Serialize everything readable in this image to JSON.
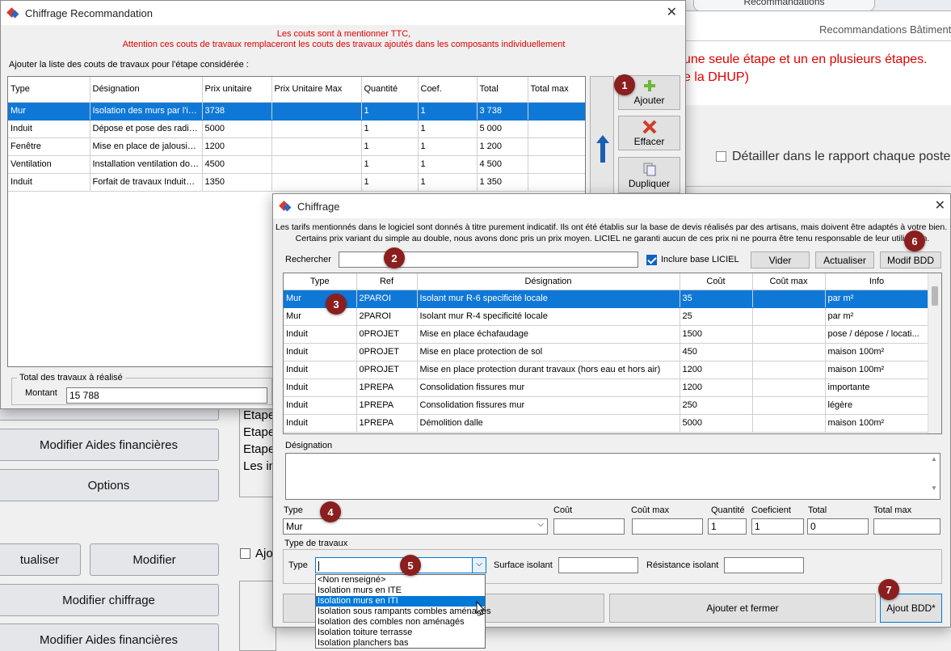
{
  "background": {
    "tab_recommandations": "Recommandations",
    "breadcrumb": "Recommandations Bâtiment",
    "red_line_1": "une seule étape et un en plusieurs étapes.",
    "red_line_2": "e la DHUP)",
    "detailler": "Détailler dans le rapport chaque poste c",
    "etape_1": "Etape",
    "etape_2": "Etape",
    "etape_3": "Etape",
    "les_in": "Les in",
    "ajo": "Ajo",
    "buttons": {
      "modifier_aides_1": "Modifier Aides financières",
      "options": "Options",
      "actualiser": "tualiser",
      "modifier": "Modifier",
      "modifier_chiffrage": "Modifier chiffrage",
      "modifier_aides_2": "Modifier Aides financières"
    }
  },
  "recommandation_window": {
    "title": "Chiffrage Recommandation",
    "warning_1": "Les couts sont à mentionner TTC,",
    "warning_2": "Attention ces couts de travaux remplaceront les couts des travaux ajoutés dans les composants individuellement",
    "list_label": "Ajouter la liste des couts de travaux pour l'étape considérée :",
    "columns": [
      "Type",
      "Désignation",
      "Prix unitaire",
      "Prix Unitaire Max",
      "Quantité",
      "Coef.",
      "Total",
      "Total max"
    ],
    "rows": [
      [
        "Mur",
        "Isolation des murs par l'int...",
        "3738",
        "",
        "1",
        "1",
        "3 738",
        ""
      ],
      [
        "Induit",
        "Dépose et pose des radia...",
        "5000",
        "",
        "1",
        "1",
        "5 000",
        ""
      ],
      [
        "Fenêtre",
        "Mise en place de jalousie...",
        "1200",
        "",
        "1",
        "1",
        "1 200",
        ""
      ],
      [
        "Ventilation",
        "Installation ventilation dou...",
        "4500",
        "",
        "1",
        "1",
        "4 500",
        ""
      ],
      [
        "Induit",
        "Forfait de travaux Induits ...",
        "1350",
        "",
        "1",
        "1",
        "1 350",
        ""
      ]
    ],
    "btn_ajouter": "Ajouter",
    "btn_effacer": "Effacer",
    "btn_dupliquer": "Dupliquer",
    "total_group": "Total des travaux à réalisé",
    "montant_label": "Montant",
    "montant_value": "15 788"
  },
  "chiffrage_window": {
    "title": "Chiffrage",
    "info_1": "Les tarifs mentionnés dans le logiciel sont donnés à titre purement indicatif. Ils ont été établis sur la base de devis réalisés par des artisans, mais doivent être adaptés à votre bien.",
    "info_2": "Certains prix variant du simple au double, nous avons donc pris un prix moyen. LICIEL ne garanti aucun de ces prix ni ne pourra être tenu responsable de leur utilisation.",
    "rechercher_label": "Rechercher",
    "rechercher_value": "",
    "inclure_label": "Inclure base LICIEL",
    "btn_vider": "Vider",
    "btn_actualiser": "Actualiser",
    "btn_modif_bdd": "Modif BDD",
    "columns": [
      "Type",
      "Ref",
      "Désignation",
      "Coût",
      "Coût max",
      "Info"
    ],
    "rows": [
      [
        "Mur",
        "2PAROI",
        "Isolant mur R-6 specificité locale",
        "35",
        "",
        "par m²"
      ],
      [
        "Mur",
        "2PAROI",
        "Isolant mur R-4 specificité locale",
        "25",
        "",
        "par m²"
      ],
      [
        "Induit",
        "0PROJET",
        "Mise en place échafaudage",
        "1500",
        "",
        "pose / dépose / locati..."
      ],
      [
        "Induit",
        "0PROJET",
        "Mise en place protection de sol",
        "450",
        "",
        "maison 100m²"
      ],
      [
        "Induit",
        "0PROJET",
        "Mise en place protection durant travaux (hors eau et hors air)",
        "1200",
        "",
        "maison 100m²"
      ],
      [
        "Induit",
        "1PREPA",
        "Consolidation fissures mur",
        "1200",
        "",
        "importante"
      ],
      [
        "Induit",
        "1PREPA",
        "Consolidation fissures mur",
        "250",
        "",
        "légère"
      ],
      [
        "Induit",
        "1PREPA",
        "Démolition dalle",
        "5000",
        "",
        "maison 100m²"
      ]
    ],
    "designation_label": "Désignation",
    "type_label": "Type",
    "type_value": "Mur",
    "cout_label": "Coût",
    "cout_max_label": "Coût max",
    "quantite_label": "Quantité",
    "quantite_value": "1",
    "coeficient_label": "Coeficient",
    "coeficient_value": "1",
    "total_label": "Total",
    "total_value": "0",
    "total_max_label": "Total max",
    "type_travaux_group": "Type de travaux",
    "tt_type_label": "Type",
    "surface_label": "Surface isolant",
    "resistance_label": "Résistance isolant",
    "dropdown_options": [
      "<Non renseigné>",
      "Isolation murs en ITE",
      "Isolation murs en ITI",
      "Isolation sous rampants combles aménagés",
      "Isolation des combles non aménagés",
      "Isolation toiture terrasse",
      "Isolation planchers bas"
    ],
    "btn_ajouter_fermer": "Ajouter et fermer",
    "btn_ajout_bdd": "Ajout BDD*"
  },
  "badges": [
    "1",
    "2",
    "3",
    "4",
    "5",
    "6",
    "7"
  ]
}
